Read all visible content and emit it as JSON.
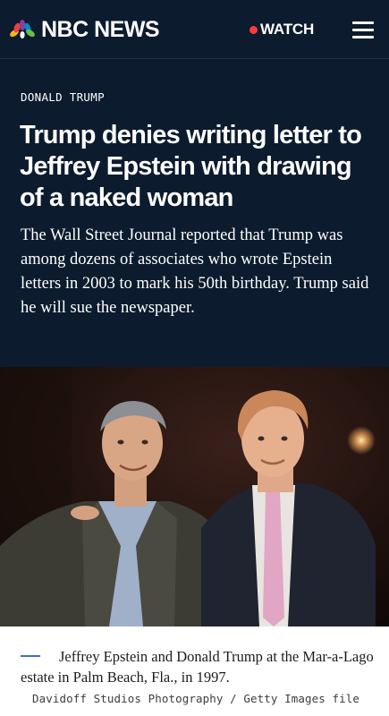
{
  "header": {
    "brand": "NBC NEWS",
    "watch_label": "WATCH",
    "colors": {
      "background": "#0c1b2e",
      "live_dot": "#ff3b3b"
    },
    "icons": [
      "nbc-peacock-icon",
      "live-dot-icon",
      "hamburger-menu-icon"
    ]
  },
  "article": {
    "kicker": "DONALD TRUMP",
    "headline": "Trump denies writing letter to Jeffrey Epstein with drawing of a naked woman",
    "dek": "The Wall Street Journal reported that Trump was among dozens of associates who wrote Epstein letters in 2003 to mark his 50th birthday. Trump said he will sue the newspaper."
  },
  "photo": {
    "caption": "Jeffrey Epstein and Donald Trump at the Mar-a-Lago estate in Palm Beach, Fla., in 1997.",
    "credit": "Davidoff Studios Photography / Getty Images file"
  }
}
